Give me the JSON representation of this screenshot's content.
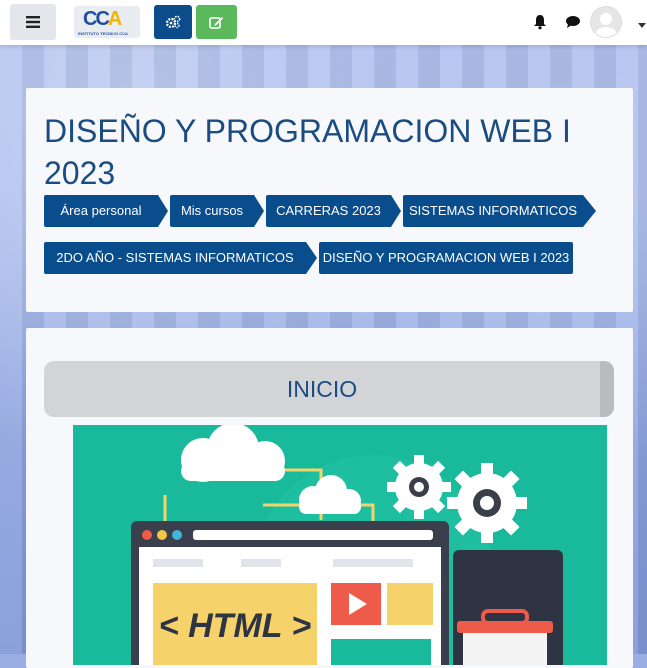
{
  "navbar": {
    "menu_icon": "hamburger-icon",
    "logo_text": "CCA",
    "logo_subtext": "INSTITUTO TECNICO CCA",
    "settings_icon": "cogs-icon",
    "edit_icon": "edit-icon",
    "notifications_icon": "bell-icon",
    "messages_icon": "chat-icon",
    "user_icon": "avatar-icon",
    "user_menu_icon": "caret-down-icon"
  },
  "course": {
    "title": "DISEÑO Y PROGRAMACION WEB I 2023"
  },
  "breadcrumb": [
    "Área personal",
    "Mis cursos",
    "CARRERAS 2023",
    "SISTEMAS INFORMATICOS",
    "2DO AÑO - SISTEMAS INFORMATICOS",
    "DISEÑO Y PROGRAMACION WEB I 2023"
  ],
  "section": {
    "title": "INICIO"
  },
  "illustration": {
    "html_label": "< HTML >",
    "background_color": "#19b99b"
  },
  "colors": {
    "primary": "#0a4d8c",
    "success": "#5cb85c",
    "title": "#1a4c82"
  }
}
